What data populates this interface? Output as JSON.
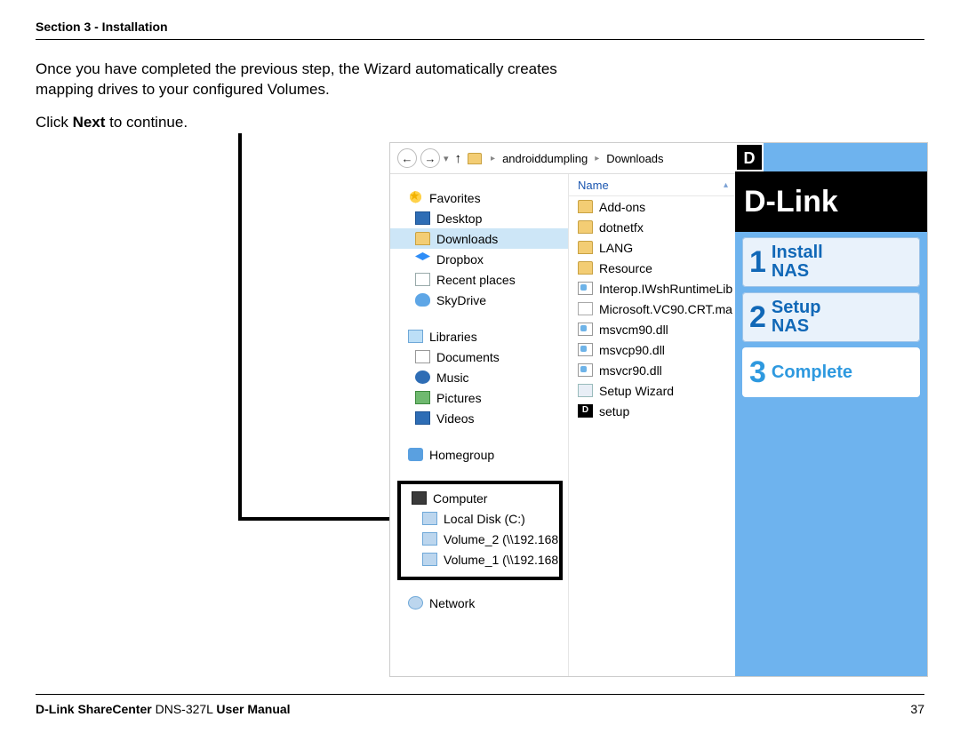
{
  "header": {
    "section": "Section 3 - Installation"
  },
  "body": {
    "para1": "Once you have completed the previous step, the Wizard automatically creates mapping drives to your configured Volumes.",
    "para2_pre": "Click ",
    "para2_bold": "Next",
    "para2_post": " to continue."
  },
  "explorer": {
    "breadcrumb": {
      "folder1": "androiddumpling",
      "folder2": "Downloads"
    },
    "favorites_label": "Favorites",
    "favorites": [
      "Desktop",
      "Downloads",
      "Dropbox",
      "Recent places",
      "SkyDrive"
    ],
    "libraries_label": "Libraries",
    "libraries": [
      "Documents",
      "Music",
      "Pictures",
      "Videos"
    ],
    "homegroup_label": "Homegroup",
    "computer_label": "Computer",
    "computer": [
      "Local Disk (C:)",
      "Volume_2 (\\\\192.168",
      "Volume_1 (\\\\192.168"
    ],
    "network_label": "Network",
    "col_name": "Name",
    "files": [
      {
        "name": "Add-ons",
        "icon": "folder"
      },
      {
        "name": "dotnetfx",
        "icon": "folder"
      },
      {
        "name": "LANG",
        "icon": "folder"
      },
      {
        "name": "Resource",
        "icon": "folder"
      },
      {
        "name": "Interop.IWshRuntimeLib",
        "icon": "dll"
      },
      {
        "name": "Microsoft.VC90.CRT.ma",
        "icon": "file"
      },
      {
        "name": "msvcm90.dll",
        "icon": "dll"
      },
      {
        "name": "msvcp90.dll",
        "icon": "dll"
      },
      {
        "name": "msvcr90.dll",
        "icon": "dll"
      },
      {
        "name": "Setup Wizard",
        "icon": "wiz"
      },
      {
        "name": "setup",
        "icon": "dlink"
      }
    ]
  },
  "wizard": {
    "tab_letter": "D",
    "brand": "D-Link",
    "steps": [
      {
        "num": "1",
        "label": "Install\nNAS",
        "active": true
      },
      {
        "num": "2",
        "label": "Setup\nNAS",
        "active": true
      },
      {
        "num": "3",
        "label": "Complete",
        "active": false
      }
    ]
  },
  "footer": {
    "product_bold1": "D-Link ShareCenter",
    "product_mid": " DNS-327L ",
    "product_bold2": "User Manual",
    "page": "37"
  }
}
